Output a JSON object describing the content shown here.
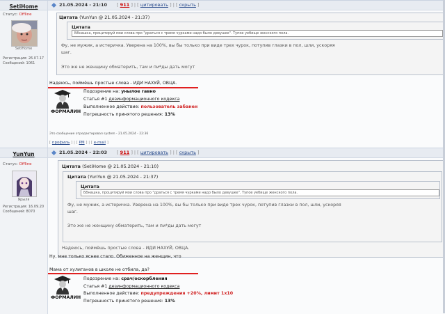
{
  "post1": {
    "username": "SetiHome",
    "status_label": "Статус:",
    "status_value": "Offline",
    "avatar_name": "SetiHome",
    "reg_label": "Регистрация:",
    "reg_date": "26.07.17",
    "msgs_label": "Сообщений:",
    "msgs_count": "1061",
    "header": {
      "date": "21.05.2024 - 21:10",
      "open": "[",
      "num": "911",
      "sep1": "] | [",
      "quote_link": "цитировать",
      "sep2": "] | [",
      "hide_link": "скрыть",
      "close": "]"
    },
    "quote": {
      "title": "Цитата",
      "meta": "(YunYun @ 21.05.2024 - 21:37)",
      "inner_title": "Цитата",
      "inner_text": "Ббнашка, процитируй мои слова про \"драться с тремя чурками надо было девушке\". Тупое уебище женского пола.",
      "line1": "Фу, не мужик, а истеричка. Уверена на 100%, вы бы только при виде трех чурок, потупив глазки в пол, шли, ускоряя",
      "line2": "шаг.",
      "line3": "Это же не женщину обматерить, там и пи*ды дать могут"
    },
    "main_text": "Надеюсь, поймёшь простые слова - ИДИ НАХУЙ, ОВЦА.",
    "verdict": {
      "label": "ФОРМАЛИН",
      "suspicion_label": "Подозрение на:",
      "suspicion_value": "унылое гавно",
      "article_prefix": "Статья #1",
      "article_value": "дезинформационного кодекса",
      "action_label": "Выполненное действие:",
      "action_value": "пользователь забанен",
      "error_label": "Погрешность принятого решения:",
      "error_value": "13%"
    },
    "edited": "Это сообщение отредактировал system - 21.05.2024 - 22:36",
    "footer": {
      "open": "[",
      "profile": "профиль",
      "sep1": "] | [",
      "pm": "PM",
      "sep2": "] | [",
      "email": "e-mail",
      "close": "]"
    }
  },
  "post2": {
    "username": "YunYun",
    "status_label": "Статус:",
    "status_value": "Offline",
    "avatar_name": "Ярыля",
    "reg_label": "Регистрация:",
    "reg_date": "16.09.20",
    "msgs_label": "Сообщений:",
    "msgs_count": "8070",
    "header": {
      "date": "21.05.2024 - 22:03",
      "open": "[",
      "num": "911",
      "sep1": "] | [",
      "quote_link": "цитировать",
      "sep2": "] | [",
      "hide_link": "скрыть",
      "close": "]"
    },
    "quote": {
      "title": "Цитата",
      "meta": "(SetiHome @ 21.05.2024 - 21:10)",
      "inner_title": "Цитата",
      "inner_meta": "(YunYun @ 21.05.2024 - 21:37)",
      "deep_title": "Цитата",
      "deep_text": "Ббнашка, процитируй мои слова про \"драться с тремя чурками надо было девушке\". Тупое уебище женского пола.",
      "line1": "Фу, не мужик, а истеричка. Уверена на 100%, вы бы только при виде трех чурок, потупив глазки в пол, шли, ускоряя",
      "line2": "шаг.",
      "line3": "Это же не женщину обматерить, там и пи*ды дать могут",
      "line4": "Надеюсь, поймёшь простые слова - ИДИ НАХУЙ, ОВЦА."
    },
    "text1": "Ну, мне только яснее стало. Обиженное на женщин, что",
    "main_text": "Мама от хулиганов в школе не отбила, да?",
    "verdict": {
      "label": "ФОРМАЛИН",
      "suspicion_label": "Подозрение на:",
      "suspicion_value": "срач/оскорбления",
      "article_prefix": "Статья #1",
      "article_value": "дезинформационного кодекса",
      "action_label": "Выполненное действие:",
      "action_value": "предупреждения +20%, лимит 1x10",
      "error_label": "Погрешность принятого решения:",
      "error_value": "13%"
    }
  },
  "colors": {
    "accent_red": "#d02020",
    "link_blue": "#2a4c8c",
    "header_bg": "#e7ebf1"
  }
}
